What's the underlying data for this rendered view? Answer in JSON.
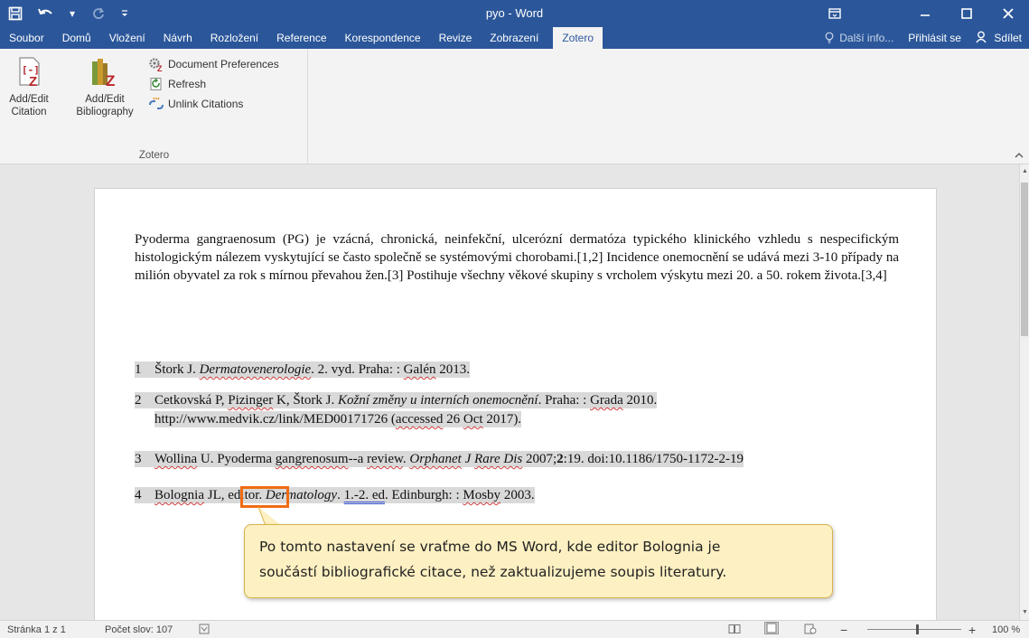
{
  "window": {
    "title": "pyo - Word",
    "qat": {
      "save_icon": "save-icon",
      "undo_icon": "undo-icon",
      "redo_icon": "redo-icon",
      "customize_icon": "customize-qat-icon"
    }
  },
  "tabs": {
    "items": [
      "Soubor",
      "Domů",
      "Vložení",
      "Návrh",
      "Rozložení",
      "Reference",
      "Korespondence",
      "Revize",
      "Zobrazení",
      "Zotero"
    ],
    "active": "Zotero",
    "help": "Další info...",
    "signin": "Přihlásit se",
    "share": "Sdílet"
  },
  "ribbon": {
    "group_label": "Zotero",
    "add_edit_citation": {
      "line1": "Add/Edit",
      "line2": "Citation"
    },
    "add_edit_bibliography": {
      "line1": "Add/Edit",
      "line2": "Bibliography"
    },
    "document_preferences": "Document Preferences",
    "refresh": "Refresh",
    "unlink_citations": "Unlink Citations"
  },
  "document": {
    "paragraph": "Pyoderma gangraenosum (PG) je vzácná, chronická, neinfekční, ulcerózní dermatóza typického klinického vzhledu s nespecifickým histologickým nálezem vyskytující se často společně se systémovými chorobami.[1,2] Incidence onemocnění se udává mezi 3-10 případy na milión obyvatel za rok s mírnou převahou žen.[3] Postihuje všechny věkové skupiny s vrcholem výskytu mezi 20. a 50. rokem života.[3,4]",
    "references": [
      {
        "num": "1",
        "a": "Štork J. ",
        "title": "Dermatovenerologie",
        "b": ". 2. vyd. Praha: : ",
        "publisher": "Galén",
        "c": " 2013."
      },
      {
        "num": "2",
        "a": "Cetkovská P, ",
        "p2": "Pizinger",
        "a2": " K, Štork J. ",
        "title": "Kožní změny u interních onemocnění",
        "b": ". Praha: : ",
        "publisher": "Grada",
        "c": " 2010.",
        "line2a": "http://www.medvik.cz/link/MED00171726 (",
        "accessed": "accessed",
        "line2b": " 26 ",
        "oct": "Oct",
        "line2c": " 2017)."
      },
      {
        "num": "3",
        "a": "Wollina",
        "a2": " U. Pyoderma ",
        "w2": "gangrenosum",
        "a3": "--a ",
        "w3": "review",
        "b": ". ",
        "j1": "Orphanet",
        "j2": " J ",
        "j3": "Rare Dis",
        "c": " 2007;",
        "vol": "2",
        "d": ":19. doi:10.1186/1750-1172-2-19"
      },
      {
        "num": "4",
        "a": "Bolognia",
        "a2": " JL, ",
        "editor": "editor",
        "a3": ". ",
        "title": "Dermatology",
        "b": ". ",
        "ed1": "1.-2. ed",
        "c": ". Edinburgh: : ",
        "publisher": "Mosby",
        "d": " 2003."
      }
    ]
  },
  "callout": {
    "line1": "Po tomto nastavení se vraťme do MS Word, kde editor Bolognia je",
    "line2": "součástí bibliografické citace, než zaktualizujeme soupis literatury."
  },
  "status": {
    "page": "Stránka 1 z 1",
    "words": "Počet slov: 107",
    "zoom": "100 %"
  }
}
